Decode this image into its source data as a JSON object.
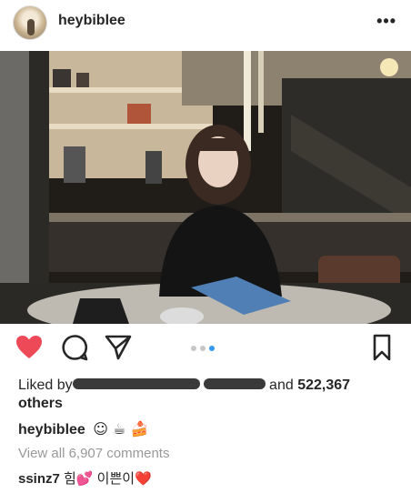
{
  "post": {
    "username": "heybiblee",
    "more_label": "•••"
  },
  "likes": {
    "prefix": "Liked by",
    "suffix_connector": "and",
    "count": "522,367",
    "suffix_tail": "others"
  },
  "caption": {
    "username": "heybiblee",
    "emojis": "☺ ☕ 🍰"
  },
  "comments": {
    "view_all": "View all 6,907 comments",
    "items": [
      {
        "username": "ssinz7",
        "text": "힘💕 이쁜이❤️"
      }
    ]
  },
  "carousel": {
    "count": 3,
    "active_index": 2
  },
  "colors": {
    "heart": "#ed4956",
    "dot_active": "#3897f0",
    "dot_inactive": "#c7c7c7",
    "muted_text": "#999999"
  },
  "icons": [
    "more-icon",
    "heart-icon",
    "comment-icon",
    "share-icon",
    "bookmark-icon"
  ]
}
